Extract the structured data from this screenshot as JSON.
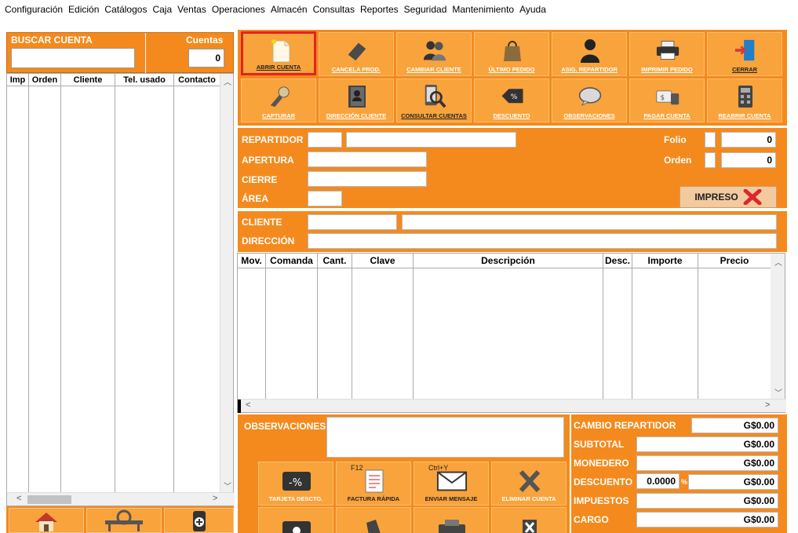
{
  "menu": [
    "Configuración",
    "Edición",
    "Catálogos",
    "Caja",
    "Ventas",
    "Operaciones",
    "Almacén",
    "Consultas",
    "Reportes",
    "Seguridad",
    "Mantenimiento",
    "Ayuda"
  ],
  "left": {
    "buscar_label": "BUSCAR CUENTA",
    "buscar_value": "",
    "cuentas_label": "Cuentas",
    "cuentas_value": "0",
    "columns": [
      "Imp",
      "Orden",
      "Cliente",
      "Tel. usado",
      "Contacto"
    ]
  },
  "toolbar": {
    "row1": [
      {
        "label": "ABRIR CUENTA",
        "icon": "new-document-icon",
        "enabled": true,
        "active": true
      },
      {
        "label": "CANCELA PROD.",
        "icon": "eraser-icon",
        "enabled": false
      },
      {
        "label": "CAMBIAR CLIENTE",
        "icon": "users-icon",
        "enabled": false
      },
      {
        "label": "ÚLTIMO PEDIDO",
        "icon": "bag-icon",
        "enabled": false
      },
      {
        "label": "ASIG. REPARTIDOR",
        "icon": "delivery-person-icon",
        "enabled": false
      },
      {
        "label": "IMPRIMIR PEDIDO",
        "icon": "printer-icon",
        "enabled": false
      },
      {
        "label": "CERRAR",
        "icon": "exit-door-icon",
        "enabled": true
      }
    ],
    "row2": [
      {
        "label": "CAPTURAR",
        "icon": "hand-icon",
        "enabled": false
      },
      {
        "label": "DIRECCIÓN CLIENTE",
        "icon": "address-book-icon",
        "enabled": false
      },
      {
        "label": "CONSULTAR CUENTAS",
        "icon": "search-phone-icon",
        "enabled": true
      },
      {
        "label": "DESCUENTO",
        "icon": "discount-tag-icon",
        "enabled": false
      },
      {
        "label": "OBSERVACIONES",
        "icon": "speech-bubble-icon",
        "enabled": false
      },
      {
        "label": "PAGAR CUENTA",
        "icon": "pay-icon",
        "enabled": false
      },
      {
        "label": "REABRIR CUENTA",
        "icon": "calculator-icon",
        "enabled": false
      }
    ]
  },
  "info": {
    "repartidor": "REPARTIDOR",
    "apertura": "APERTURA",
    "cierre": "CIERRE",
    "area": "ÁREA",
    "folio_label": "Folio",
    "folio_value": "0",
    "orden_label": "Orden",
    "orden_value": "0",
    "impreso": "IMPRESO"
  },
  "cliente": {
    "cliente_label": "CLIENTE",
    "direccion_label": "DIRECCIÓN"
  },
  "detail_columns": [
    "Mov.",
    "Comanda",
    "Cant.",
    "Clave",
    "Descripción",
    "Desc.",
    "Importe",
    "Precio"
  ],
  "bottom": {
    "observaciones_label": "OBSERVACIONES",
    "buttons_row1": [
      {
        "label": "TARJETA DESCTO.",
        "icon": "discount-card-icon",
        "enabled": false,
        "key": ""
      },
      {
        "label": "FACTURA RÁPIDA",
        "icon": "invoice-icon",
        "enabled": true,
        "key": "F12"
      },
      {
        "label": "ENVIAR MENSAJE",
        "icon": "envelope-icon",
        "enabled": true,
        "key": "Ctrl+Y"
      },
      {
        "label": "ELIMINAR CUENTA",
        "icon": "delete-x-icon",
        "enabled": false,
        "key": ""
      }
    ]
  },
  "totals": {
    "cambio_repartidor_label": "CAMBIO REPARTIDOR",
    "cambio_repartidor_value": "G$0.00",
    "subtotal_label": "SUBTOTAL",
    "subtotal_value": "G$0.00",
    "monedero_label": "MONEDERO",
    "monedero_value": "G$0.00",
    "descuento_label": "DESCUENTO",
    "descuento_pct": "0.0000",
    "pct_sign": "%",
    "descuento_value": "G$0.00",
    "impuestos_label": "IMPUESTOS",
    "impuestos_value": "G$0.00",
    "cargo_label": "CARGO",
    "cargo_value": "G$0.00"
  }
}
